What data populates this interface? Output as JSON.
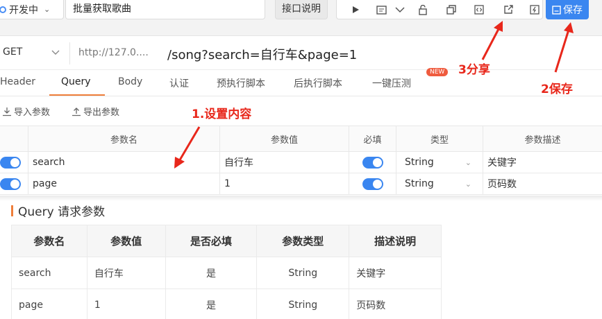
{
  "toolbar": {
    "status": "开发中",
    "request_name": "批量获取歌曲",
    "api_doc_label": "接口说明",
    "save_label": "保存",
    "icons": [
      "play-icon",
      "doc-icon",
      "chevron-down-icon",
      "unlock-icon",
      "copy-icon",
      "code-icon",
      "share-icon",
      "external-icon"
    ]
  },
  "url": {
    "method": "GET",
    "base": "http://127.0....",
    "path": "/song?search=自行车&page=1"
  },
  "tabs": [
    "Header",
    "Query",
    "Body",
    "认证",
    "预执行脚本",
    "后执行脚本",
    "一键压测"
  ],
  "new_badge": "NEW",
  "io": {
    "import": "导入参数",
    "export": "导出参数"
  },
  "param_table": {
    "headers": [
      "参数名",
      "参数值",
      "必填",
      "类型",
      "参数描述"
    ],
    "rows": [
      {
        "name": "search",
        "value": "自行车",
        "type": "String",
        "desc": "关键字"
      },
      {
        "name": "page",
        "value": "1",
        "type": "String",
        "desc": "页码数"
      }
    ]
  },
  "doc": {
    "title": "Query 请求参数",
    "headers": [
      "参数名",
      "参数值",
      "是否必填",
      "参数类型",
      "描述说明"
    ],
    "rows": [
      [
        "search",
        "自行车",
        "是",
        "String",
        "关键字"
      ],
      [
        "page",
        "1",
        "是",
        "String",
        "页码数"
      ]
    ]
  },
  "annotations": {
    "step1": "1.设置内容",
    "step2": "2保存",
    "step3": "3分享"
  },
  "colors": {
    "accent": "#3a86f0",
    "tab_underline": "#ef7e3a",
    "annotation": "#e8271b",
    "badge": "#ef5b3e"
  }
}
